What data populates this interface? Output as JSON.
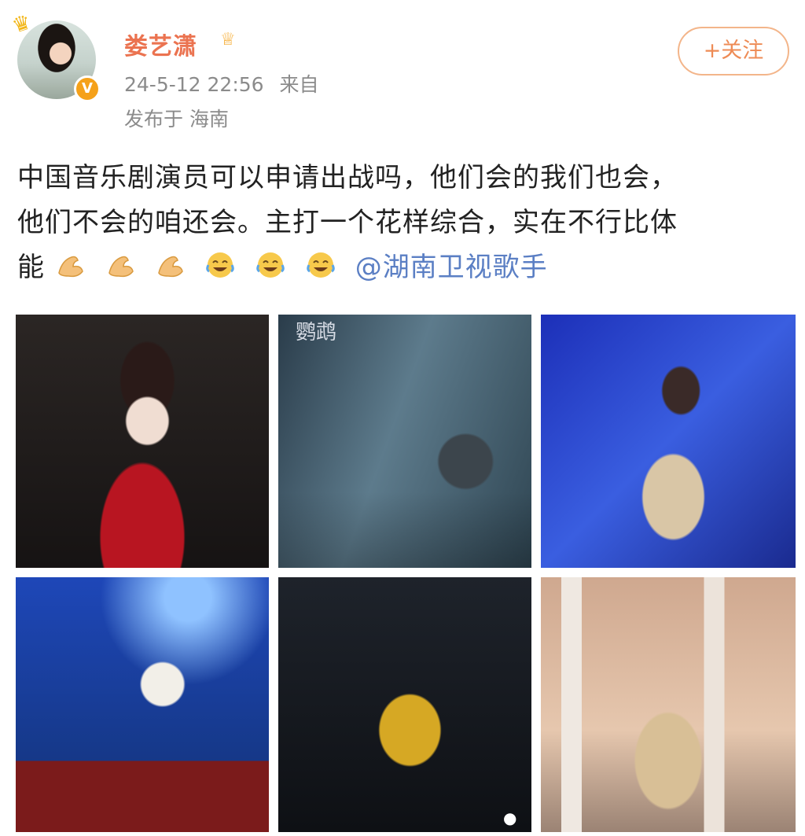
{
  "post": {
    "username": "娄艺潇",
    "timestamp": "24-5-12 22:56",
    "source_label": "来自",
    "location": "发布于 海南",
    "follow_label": "+关注",
    "text_line1": "中国音乐剧演员可以申请出战吗，他们会的我们也会，",
    "text_line2": "他们不会的咱还会。主打一个花样综合，实在不行比体",
    "text_line3_start": "能",
    "mention": "@湖南卫视歌手"
  },
  "icons": {
    "verified": "verified-v-badge",
    "crown": "crown-icon",
    "emoji_strong": "flexed-biceps-emoji",
    "emoji_laugh": "laughing-tears-emoji"
  },
  "colors": {
    "username": "#eb7350",
    "mention": "#5b7fc4",
    "follow_border": "#f3b58a",
    "meta_gray": "#8b8b8b"
  },
  "images": {
    "poster_title": "鹦鹉"
  }
}
